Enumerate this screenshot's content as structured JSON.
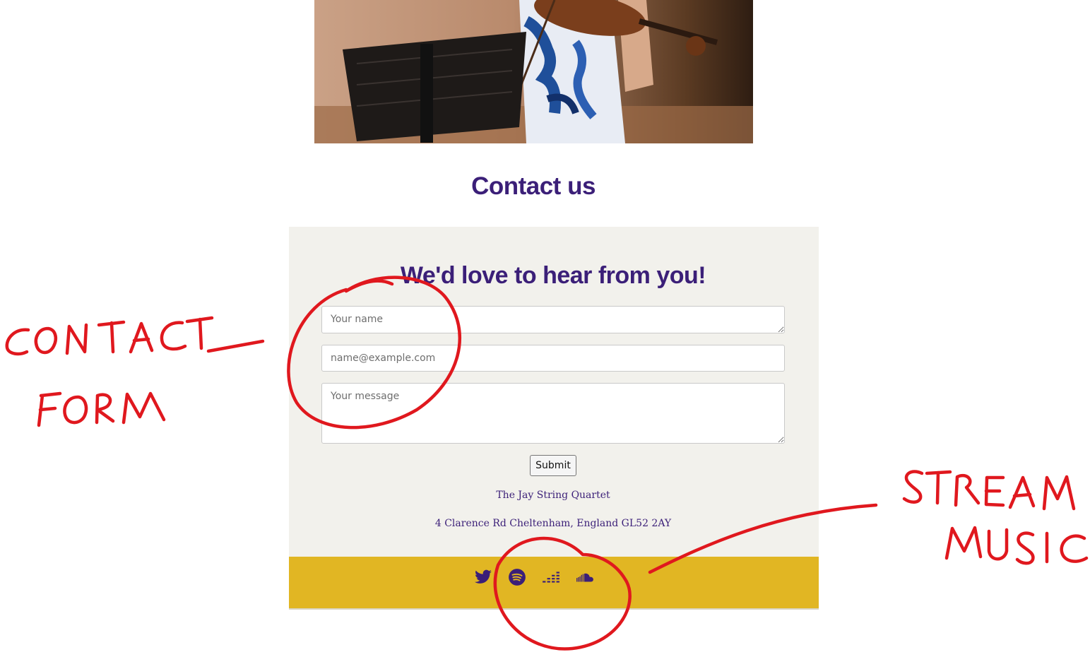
{
  "contact": {
    "section_title": "Contact us",
    "form_heading": "We'd love to hear from you!",
    "name_placeholder": "Your name",
    "email_placeholder": "name@example.com",
    "message_placeholder": "Your message",
    "submit_label": "Submit",
    "org_name": "The Jay String Quartet",
    "address": "4 Clarence Rd Cheltenham, England GL52 2AY"
  },
  "footer": {
    "background_color": "#e1b623",
    "icons": [
      "twitter-icon",
      "spotify-icon",
      "deezer-icon",
      "soundcloud-icon"
    ]
  },
  "annotations": {
    "label_left": "CONTACT_ FORM",
    "label_right": "STREAM MUSIC",
    "ink_color": "#e0181e"
  },
  "colors": {
    "brand_purple": "#3b1f78",
    "panel_background": "#f2f1ec"
  }
}
